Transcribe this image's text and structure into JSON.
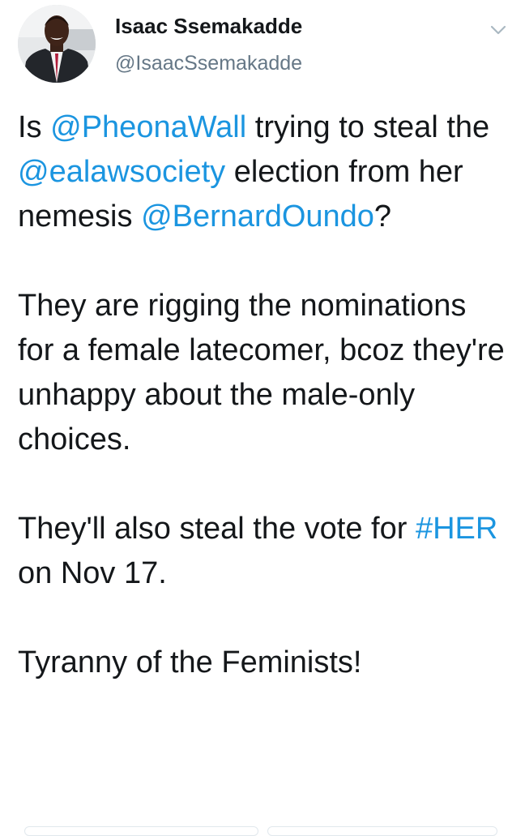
{
  "user": {
    "display_name": "Isaac Ssemakadde",
    "handle": "@IsaacSsemakadde",
    "avatar_icon": "profile-photo"
  },
  "menu_icon": "chevron-down-icon",
  "colors": {
    "link": "#1b95e0",
    "text": "#14171a",
    "secondary": "#657786",
    "divider": "#e1e8ed"
  },
  "tweet": {
    "p1": {
      "t1": "Is ",
      "m1": "@PheonaWall",
      "t2": " trying to steal the ",
      "m2": "@ealawsociety",
      "t3": " election from her nemesis ",
      "m3": "@BernardOundo",
      "t4": "?"
    },
    "p2": "They are rigging the nominations for a female latecomer, bcoz they're unhappy about the male-only choices.",
    "p3": {
      "t1": "They'll also steal the vote for ",
      "h1": "#HER",
      "t2": " on Nov 17."
    },
    "p4": "Tyranny of the Feminists!"
  }
}
